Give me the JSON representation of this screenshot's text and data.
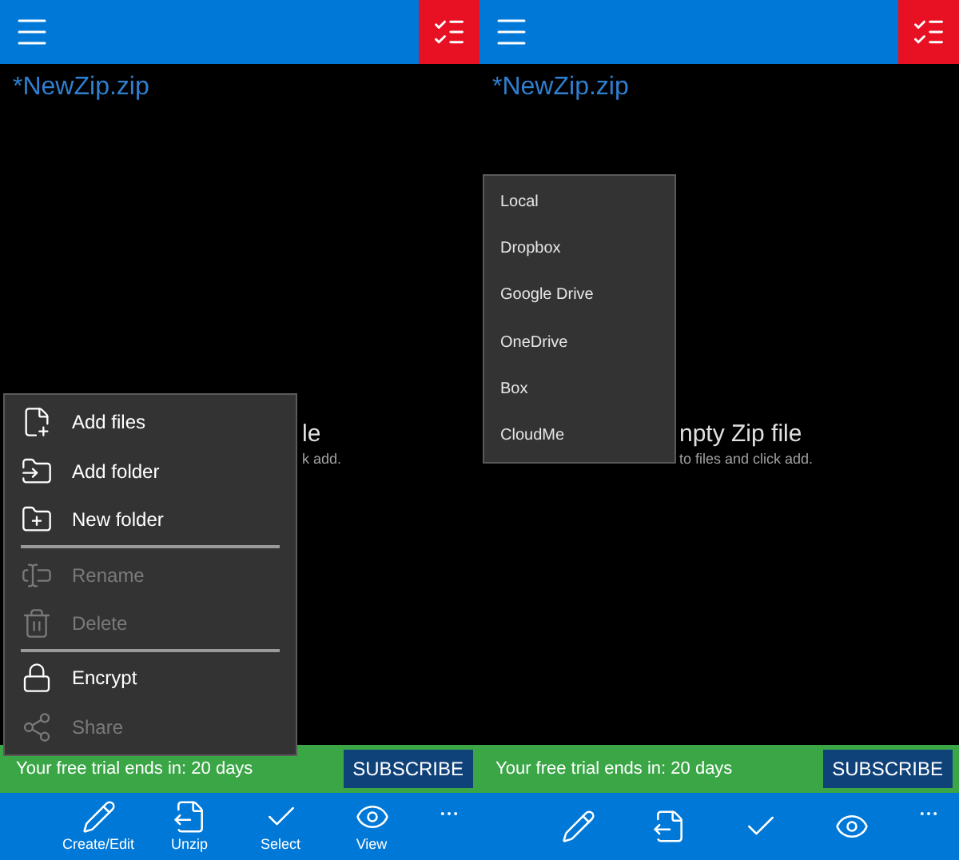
{
  "panels": [
    {
      "title": "*NewZip.zip",
      "message": {
        "line_1": "le",
        "line_2": "k add."
      },
      "trial": {
        "text": "Your free trial ends in: 20 days",
        "button": "SUBSCRIBE"
      },
      "toolbar": [
        {
          "kind": "edit",
          "label": "Create/Edit"
        },
        {
          "kind": "unzip",
          "label": "Unzip"
        },
        {
          "kind": "select",
          "label": "Select"
        },
        {
          "kind": "view",
          "label": "View"
        },
        {
          "kind": "more"
        }
      ],
      "menu": {
        "kind": "actions",
        "items": [
          {
            "kind": "add_files",
            "label": "Add files",
            "disabled": false
          },
          {
            "kind": "add_folder",
            "label": "Add folder",
            "disabled": false
          },
          {
            "kind": "new_folder",
            "label": "New folder",
            "disabled": false
          },
          {
            "kind": "separator"
          },
          {
            "kind": "rename",
            "label": "Rename",
            "disabled": true
          },
          {
            "kind": "delete",
            "label": "Delete",
            "disabled": true
          },
          {
            "kind": "separator"
          },
          {
            "kind": "encrypt",
            "label": "Encrypt",
            "disabled": false
          },
          {
            "kind": "share",
            "label": "Share",
            "disabled": true
          }
        ]
      }
    },
    {
      "title": "*NewZip.zip",
      "message": {
        "line_1": "npty Zip file",
        "line_2": "to files and click add."
      },
      "trial": {
        "text": "Your free trial ends in: 20 days",
        "button": "SUBSCRIBE"
      },
      "toolbar": [
        {
          "kind": "edit"
        },
        {
          "kind": "unzip"
        },
        {
          "kind": "select"
        },
        {
          "kind": "view"
        },
        {
          "kind": "more"
        }
      ],
      "menu": {
        "kind": "locations",
        "items": [
          {
            "kind": "location",
            "label": "Local"
          },
          {
            "kind": "location",
            "label": "Dropbox"
          },
          {
            "kind": "location",
            "label": "Google Drive"
          },
          {
            "kind": "location",
            "label": "OneDrive"
          },
          {
            "kind": "location",
            "label": "Box"
          },
          {
            "kind": "location",
            "label": "CloudMe"
          }
        ]
      }
    }
  ]
}
